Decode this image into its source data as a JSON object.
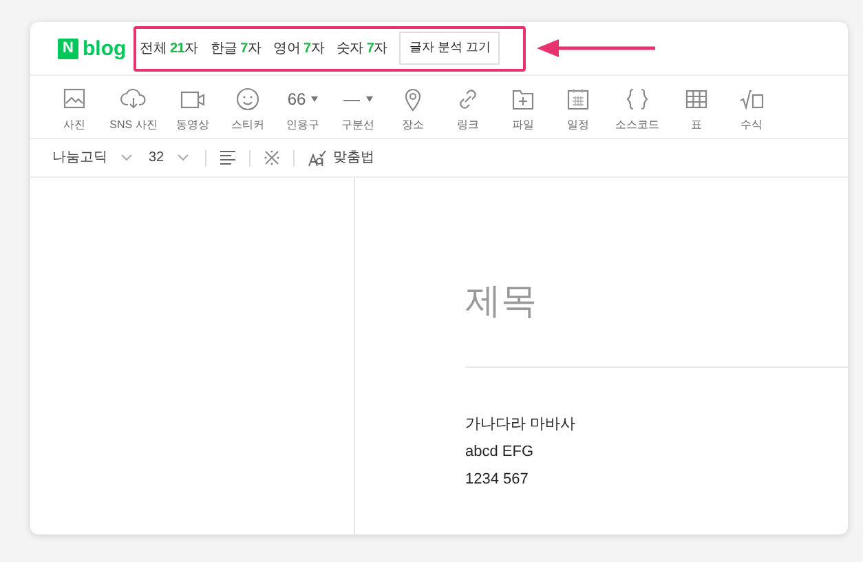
{
  "logo": {
    "badge": "N",
    "text": "blog"
  },
  "stats": [
    {
      "label": "전체",
      "count": "21",
      "unit": "자"
    },
    {
      "label": "한글",
      "count": "7",
      "unit": "자"
    },
    {
      "label": "영어",
      "count": "7",
      "unit": "자"
    },
    {
      "label": "숫자",
      "count": "7",
      "unit": "자"
    }
  ],
  "toggle_button": "글자 분석 끄기",
  "toolbar": [
    {
      "kind": "photo",
      "label": "사진"
    },
    {
      "kind": "cloud",
      "label": "SNS 사진"
    },
    {
      "kind": "video",
      "label": "동영상"
    },
    {
      "kind": "smile",
      "label": "스티커"
    },
    {
      "kind": "glyph",
      "glyph": "66",
      "label": "인용구"
    },
    {
      "kind": "glyph",
      "glyph": "—",
      "label": "구분선"
    },
    {
      "kind": "pin",
      "label": "장소"
    },
    {
      "kind": "link",
      "label": "링크"
    },
    {
      "kind": "file",
      "label": "파일"
    },
    {
      "kind": "calendar",
      "label": "일정"
    },
    {
      "kind": "braces",
      "label": "소스코드"
    },
    {
      "kind": "table",
      "label": "표"
    },
    {
      "kind": "sqrt",
      "label": "수식"
    }
  ],
  "format_bar": {
    "font": "나눔고딕",
    "size": "32",
    "spellcheck": "맞춤법"
  },
  "editor": {
    "title_placeholder": "제목",
    "lines": [
      "가나다라 마바사",
      "abcd EFG",
      "1234 567"
    ]
  }
}
